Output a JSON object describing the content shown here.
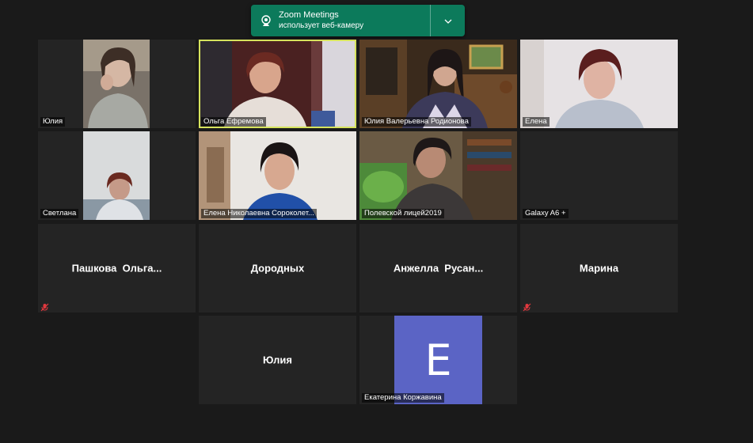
{
  "toast": {
    "title": "Zoom Meetings",
    "subtitle": "использует веб-камеру",
    "icon": "webcam-icon",
    "color": "#0c7a5b"
  },
  "tiles": [
    {
      "name": "Юлия",
      "type": "video",
      "active": false
    },
    {
      "name": "Ольга Ефремова",
      "type": "video",
      "active": true
    },
    {
      "name": "Юлия Валерьевна Родионова",
      "type": "video",
      "active": false
    },
    {
      "name": "Елена",
      "type": "video",
      "active": false
    },
    {
      "name": "Светлана",
      "type": "video",
      "active": false
    },
    {
      "name": "Елена Николаевна Сороколет...",
      "type": "video",
      "active": false
    },
    {
      "name": "Полевской лицей2019",
      "type": "video",
      "active": false
    },
    {
      "name": "Galaxy A6 +",
      "type": "video-off",
      "active": false
    },
    {
      "name": "Пашкова  Ольга...",
      "type": "no-video",
      "muted": true
    },
    {
      "name": "Дородных",
      "type": "no-video",
      "muted": false
    },
    {
      "name": "Анжелла  Русан...",
      "type": "no-video",
      "muted": false
    },
    {
      "name": "Марина",
      "type": "no-video",
      "muted": true
    },
    {
      "name": "Юлия",
      "type": "no-video",
      "muted": false
    },
    {
      "name": "Екатерина Коржавина",
      "type": "avatar",
      "initial": "E",
      "avatar_color": "#5b64c5"
    }
  ],
  "colors": {
    "active_speaker": "#d6e35d",
    "background": "#1a1a1a",
    "tile": "#242424",
    "muted": "#e0383e"
  }
}
